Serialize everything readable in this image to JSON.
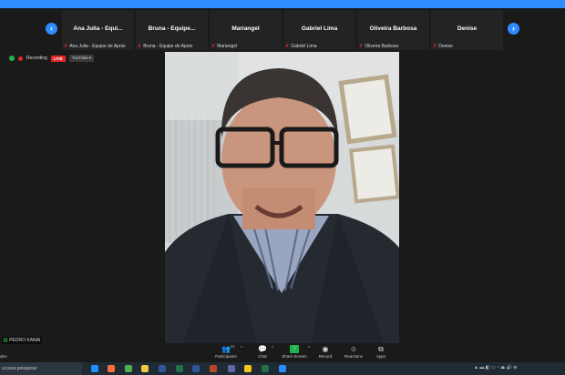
{
  "gallery": {
    "tiles": [
      {
        "name": "Ana Julia - Equi...",
        "label": "Ana Julia - Equipe de Apoio"
      },
      {
        "name": "Bruna - Equipe...",
        "label": "Bruna - Equipe de Apoio"
      },
      {
        "name": "Mariangel",
        "label": "Mariangel"
      },
      {
        "name": "Gabriel Lima",
        "label": "Gabriel Lima"
      },
      {
        "name": "Oliveira Barbosa",
        "label": "Oliveira Barbosa"
      },
      {
        "name": "Denise",
        "label": "Denise"
      }
    ],
    "prev_icon": "chevron-left-icon",
    "next_icon": "chevron-right-icon"
  },
  "status": {
    "recording": "Recording",
    "live": "LIVE",
    "youtube": "YouTube"
  },
  "speaker": {
    "name": "PEDRO KANAI"
  },
  "toolbar": {
    "left_label": "deo",
    "participants_label": "Participants",
    "participants_count": "23",
    "chat_label": "Chat",
    "share_label": "Share Screen",
    "record_label": "Record",
    "reactions_label": "Reactions",
    "apps_label": "Apps"
  },
  "taskbar": {
    "search_placeholder": "ui para pesquisar"
  },
  "colors": {
    "accent": "#2d8cff",
    "live": "#e02828",
    "share": "#23b14d"
  }
}
